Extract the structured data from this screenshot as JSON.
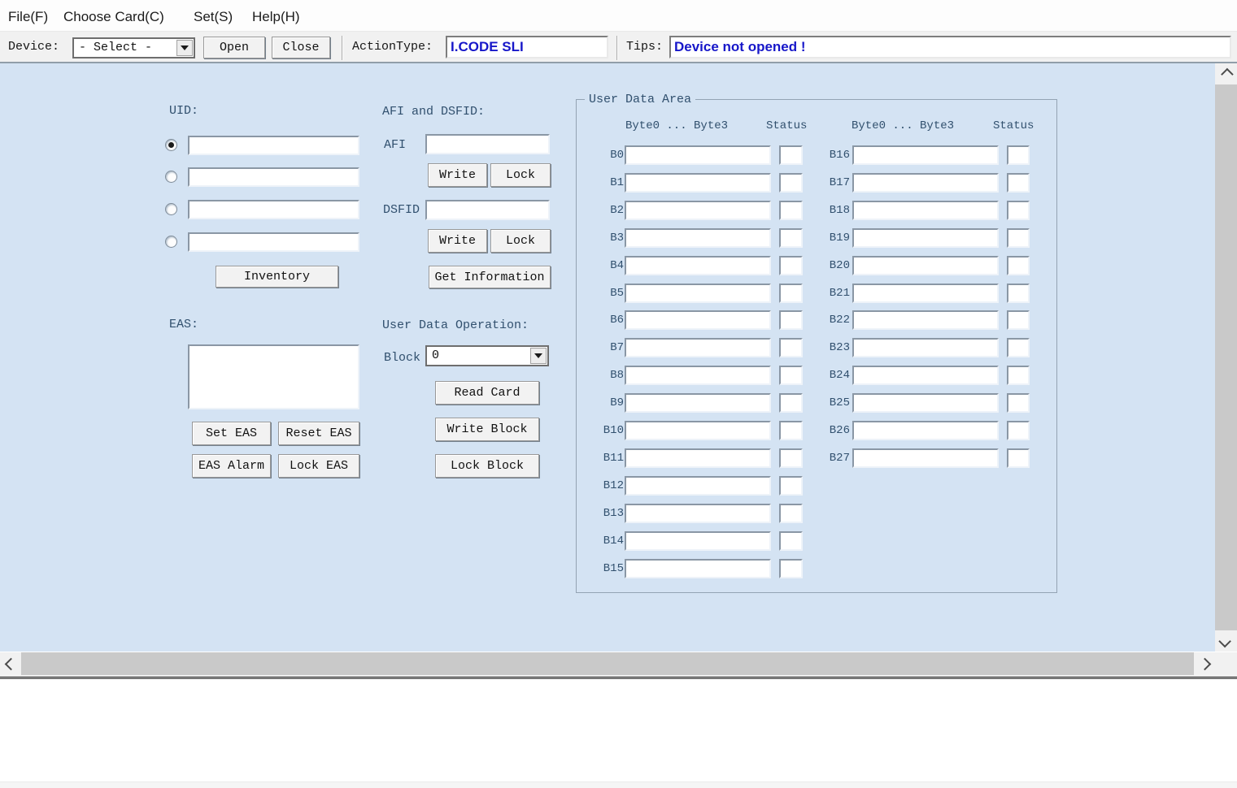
{
  "menu": {
    "items": [
      {
        "label": "File(F)"
      },
      {
        "label": "Choose Card(C)"
      },
      {
        "label": "Set(S)"
      },
      {
        "label": "Help(H)"
      }
    ]
  },
  "toolbar": {
    "device_label": "Device:",
    "device_value": "- Select -",
    "open_label": "Open",
    "close_label": "Close",
    "actiontype_label": "ActionType:",
    "actiontype_value": "I.CODE SLI",
    "tips_label": "Tips:",
    "tips_value": "Device not opened !"
  },
  "uid": {
    "title": "UID:",
    "values": [
      "",
      "",
      "",
      ""
    ],
    "selected_index": 0,
    "inventory_label": "Inventory"
  },
  "afi_dsfid": {
    "title": "AFI and DSFID:",
    "afi_label": "AFI",
    "afi_value": "",
    "write_label": "Write",
    "lock_label": "Lock",
    "dsfid_label": "DSFID",
    "dsfid_value": "",
    "write2_label": "Write",
    "lock2_label": "Lock",
    "get_information_label": "Get Information"
  },
  "eas": {
    "title": "EAS:",
    "value": "",
    "set_eas_label": "Set EAS",
    "reset_eas_label": "Reset EAS",
    "eas_alarm_label": "EAS Alarm",
    "lock_eas_label": "Lock EAS"
  },
  "user_data_operation": {
    "title": "User Data Operation:",
    "block_label": "Block",
    "block_value": "0",
    "read_card_label": "Read Card",
    "write_block_label": "Write Block",
    "lock_block_label": "Lock Block"
  },
  "user_data_area": {
    "title": "User Data Area",
    "bytes_header": "Byte0 ... Byte3",
    "status_header": "Status",
    "left_rows": [
      "B0",
      "B1",
      "B2",
      "B3",
      "B4",
      "B5",
      "B6",
      "B7",
      "B8",
      "B9",
      "B10",
      "B11",
      "B12",
      "B13",
      "B14",
      "B15"
    ],
    "right_rows": [
      "B16",
      "B17",
      "B18",
      "B19",
      "B20",
      "B21",
      "B22",
      "B23",
      "B24",
      "B25",
      "B26",
      "B27"
    ],
    "row_values": "",
    "row_status": ""
  },
  "colors": {
    "content_background": "#d4e3f3",
    "accent_text_blue": "#1717c9",
    "label_dark_slate": "#31506e"
  }
}
